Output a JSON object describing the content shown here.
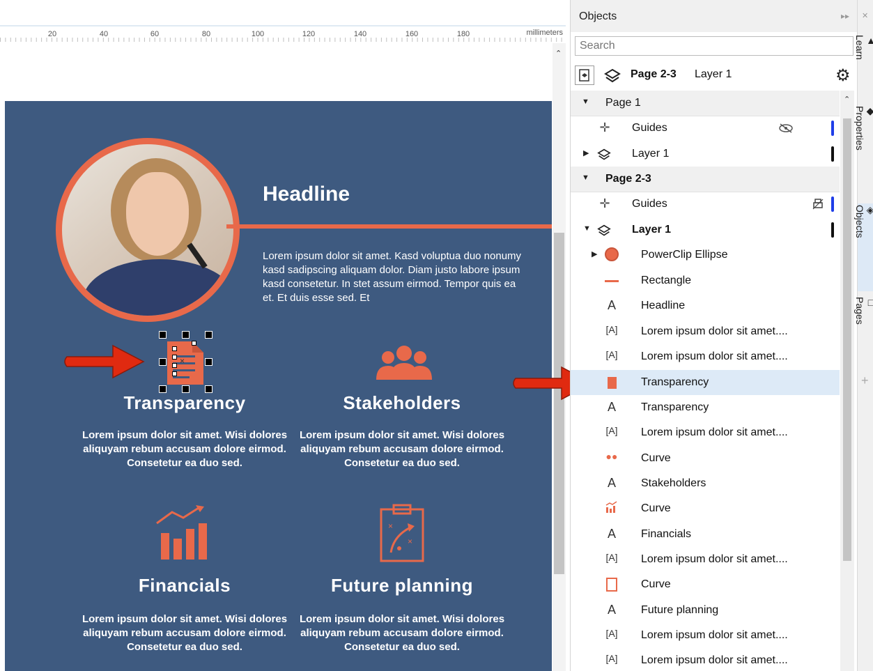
{
  "ruler": {
    "ticks": [
      "20",
      "40",
      "60",
      "80",
      "100",
      "120",
      "140",
      "160",
      "180"
    ],
    "unit": "millimeters"
  },
  "document": {
    "headline": "Headline",
    "intro": "Lorem ipsum dolor sit amet. Kasd voluptua duo nonumy kasd sadipscing aliquam dolor. Diam justo labore ipsum kasd consetetur. In stet assum eirmod. Tempor quis ea et. Et duis esse sed. Et",
    "features": [
      {
        "title": "Transparency",
        "body": "Lorem ipsum dolor sit amet. Wisi dolores aliquyam rebum accusam dolore eirmod. Consetetur ea duo sed."
      },
      {
        "title": "Stakeholders",
        "body": "Lorem ipsum dolor sit amet. Wisi dolores aliquyam rebum accusam dolore eirmod. Consetetur ea duo sed."
      },
      {
        "title": "Financials",
        "body": "Lorem ipsum dolor sit amet. Wisi dolores aliquyam rebum accusam dolore eirmod. Consetetur ea duo sed."
      },
      {
        "title": "Future planning",
        "body": "Lorem ipsum dolor sit amet. Wisi dolores aliquyam rebum accusam dolore eirmod. Consetetur ea duo sed."
      }
    ]
  },
  "docker": {
    "title": "Objects",
    "search_placeholder": "Search",
    "current_page": "Page 2-3",
    "current_layer": "Layer 1",
    "tree": [
      {
        "label": "Page 1",
        "type": "page",
        "expanded": true
      },
      {
        "label": "Guides",
        "type": "guides",
        "icon": "guides-icon",
        "extra": "eye-hidden-icon",
        "bar": "#1f3ee8"
      },
      {
        "label": "Layer 1",
        "type": "layer",
        "icon": "layers-icon",
        "bar": "#111111"
      },
      {
        "label": "Page 2-3",
        "type": "page",
        "expanded": true
      },
      {
        "label": "Guides",
        "type": "guides",
        "icon": "guides-icon",
        "extra": "print-disabled-icon",
        "bar": "#1f3ee8"
      },
      {
        "label": "Layer 1",
        "type": "layer-bold",
        "icon": "layers-icon",
        "bar": "#111111"
      },
      {
        "label": "PowerClip Ellipse",
        "type": "object",
        "icon": "powerclip-icon"
      },
      {
        "label": "Rectangle",
        "type": "object",
        "icon": "rectangle-line-icon"
      },
      {
        "label": "Headline",
        "type": "object",
        "icon": "artistic-text-icon"
      },
      {
        "label": "Lorem ipsum dolor sit amet....",
        "type": "object",
        "icon": "paragraph-text-icon"
      },
      {
        "label": "Lorem ipsum dolor sit amet....",
        "type": "object",
        "icon": "paragraph-text-icon"
      },
      {
        "label": "Transparency",
        "type": "object",
        "icon": "document-curve-icon",
        "selected": true
      },
      {
        "label": "Transparency",
        "type": "object",
        "icon": "artistic-text-icon"
      },
      {
        "label": "Lorem ipsum dolor sit amet....",
        "type": "object",
        "icon": "paragraph-text-icon"
      },
      {
        "label": "Curve",
        "type": "object",
        "icon": "people-curve-icon"
      },
      {
        "label": "Stakeholders",
        "type": "object",
        "icon": "artistic-text-icon"
      },
      {
        "label": "Curve",
        "type": "object",
        "icon": "chart-curve-icon"
      },
      {
        "label": "Financials",
        "type": "object",
        "icon": "artistic-text-icon"
      },
      {
        "label": "Lorem ipsum dolor sit amet....",
        "type": "object",
        "icon": "paragraph-text-icon"
      },
      {
        "label": "Curve",
        "type": "object",
        "icon": "clipboard-curve-icon"
      },
      {
        "label": "Future planning",
        "type": "object",
        "icon": "artistic-text-icon"
      },
      {
        "label": "Lorem ipsum dolor sit amet....",
        "type": "object",
        "icon": "paragraph-text-icon"
      },
      {
        "label": "Lorem ipsum dolor sit amet....",
        "type": "object",
        "icon": "paragraph-text-icon"
      }
    ]
  },
  "tabs": [
    {
      "label": "Learn",
      "icon": "learn-icon"
    },
    {
      "label": "Properties",
      "icon": "properties-icon"
    },
    {
      "label": "Objects",
      "icon": "objects-icon",
      "active": true
    },
    {
      "label": "Pages",
      "icon": "pages-icon"
    }
  ],
  "colors": {
    "page_bg": "#3e5a80",
    "accent": "#e8694a",
    "selection": "#ddeaf7",
    "arrow_red": "#e02a10"
  }
}
